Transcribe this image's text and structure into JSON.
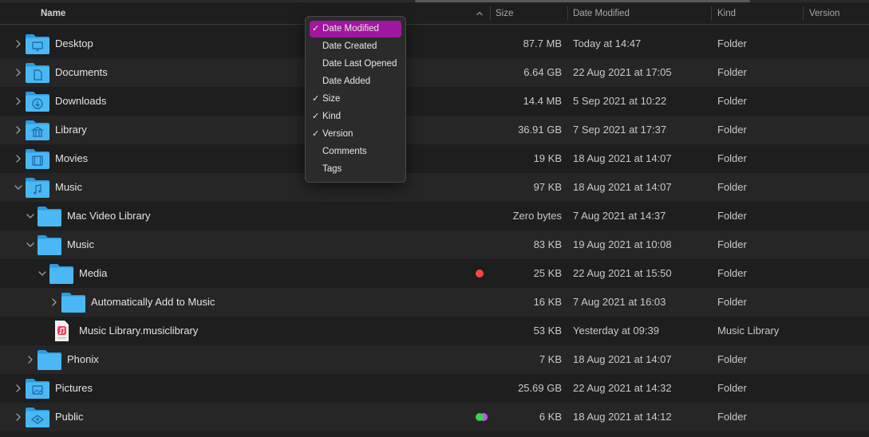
{
  "header": {
    "name": "Name",
    "size": "Size",
    "date_modified": "Date Modified",
    "kind": "Kind",
    "version": "Version",
    "sort_icon": "chevron-up-icon"
  },
  "rows": [
    {
      "name": "Desktop",
      "size": "87.7 MB",
      "date": "Today at 14:47",
      "kind": "Folder",
      "disclosure": "collapsed",
      "icon": "desktop-folder-icon"
    },
    {
      "name": "Documents",
      "size": "6.64 GB",
      "date": "22 Aug 2021 at 17:05",
      "kind": "Folder",
      "disclosure": "collapsed",
      "icon": "documents-folder-icon"
    },
    {
      "name": "Downloads",
      "size": "14.4 MB",
      "date": "5 Sep 2021 at 10:22",
      "kind": "Folder",
      "disclosure": "collapsed",
      "icon": "downloads-folder-icon"
    },
    {
      "name": "Library",
      "size": "36.91 GB",
      "date": "7 Sep 2021 at 17:37",
      "kind": "Folder",
      "disclosure": "collapsed",
      "icon": "library-folder-icon"
    },
    {
      "name": "Movies",
      "size": "19 KB",
      "date": "18 Aug 2021 at 14:07",
      "kind": "Folder",
      "disclosure": "collapsed",
      "icon": "movies-folder-icon"
    },
    {
      "name": "Music",
      "size": "97 KB",
      "date": "18 Aug 2021 at 14:07",
      "kind": "Folder",
      "disclosure": "expanded",
      "icon": "music-folder-icon"
    },
    {
      "name": "Mac Video Library",
      "size": "Zero bytes",
      "date": "7 Aug 2021 at 14:37",
      "kind": "Folder",
      "disclosure": "expanded",
      "icon": "folder-icon"
    },
    {
      "name": "Music",
      "size": "83 KB",
      "date": "19 Aug 2021 at 10:08",
      "kind": "Folder",
      "disclosure": "expanded",
      "icon": "folder-icon"
    },
    {
      "name": "Media",
      "size": "25 KB",
      "date": "22 Aug 2021 at 15:50",
      "kind": "Folder",
      "disclosure": "expanded",
      "icon": "folder-icon",
      "tags": [
        "#ff453a"
      ]
    },
    {
      "name": "Automatically Add to Music",
      "size": "16 KB",
      "date": "7 Aug 2021 at 16:03",
      "kind": "Folder",
      "disclosure": "collapsed",
      "icon": "folder-icon"
    },
    {
      "name": "Music Library.musiclibrary",
      "size": "53 KB",
      "date": "Yesterday at 09:39",
      "kind": "Music Library",
      "disclosure": "none",
      "icon": "music-library-file-icon"
    },
    {
      "name": "Phonix",
      "size": "7 KB",
      "date": "18 Aug 2021 at 14:07",
      "kind": "Folder",
      "disclosure": "collapsed",
      "icon": "folder-icon"
    },
    {
      "name": "Pictures",
      "size": "25.69 GB",
      "date": "22 Aug 2021 at 14:32",
      "kind": "Folder",
      "disclosure": "collapsed",
      "icon": "pictures-folder-icon"
    },
    {
      "name": "Public",
      "size": "6 KB",
      "date": "18 Aug 2021 at 14:12",
      "kind": "Folder",
      "disclosure": "collapsed",
      "icon": "public-folder-icon",
      "tags": [
        "#32d74b",
        "#bf5af2"
      ]
    }
  ],
  "column_menu": {
    "items": [
      {
        "label": "Date Modified",
        "checked": true,
        "selected": true
      },
      {
        "label": "Date Created",
        "checked": false,
        "selected": false
      },
      {
        "label": "Date Last Opened",
        "checked": false,
        "selected": false
      },
      {
        "label": "Date Added",
        "checked": false,
        "selected": false
      },
      {
        "label": "Size",
        "checked": true,
        "selected": false
      },
      {
        "label": "Kind",
        "checked": true,
        "selected": false
      },
      {
        "label": "Version",
        "checked": true,
        "selected": false
      },
      {
        "label": "Comments",
        "checked": false,
        "selected": false
      },
      {
        "label": "Tags",
        "checked": false,
        "selected": false
      }
    ],
    "check_glyph": "✓"
  },
  "colors": {
    "folder": "#4bb8f5",
    "folder_dark": "#2a9be0",
    "menu_highlight": "#a0169e"
  }
}
